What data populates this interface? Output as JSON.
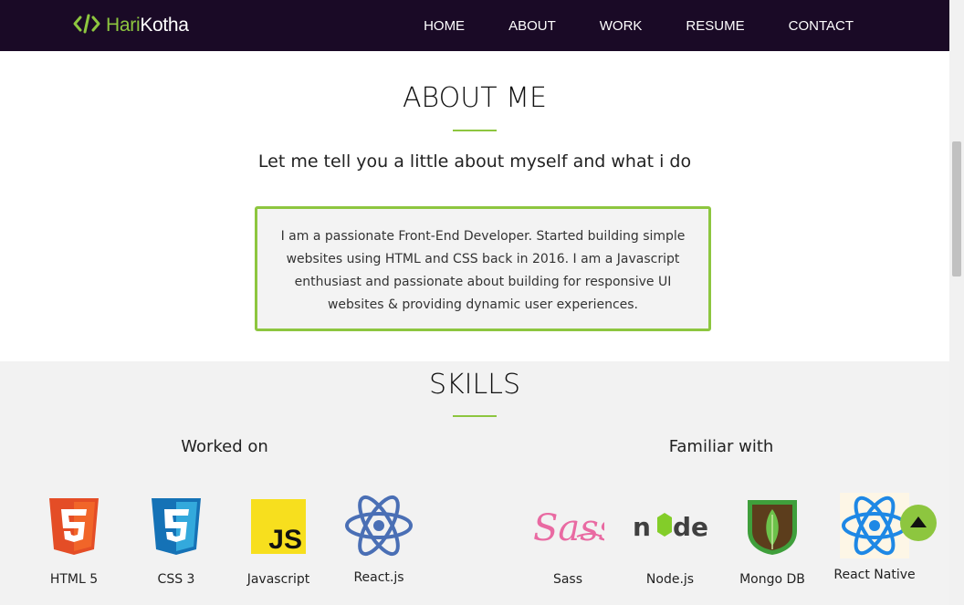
{
  "brand": {
    "part1": "Hari",
    "part2": "Kotha",
    "icon": "code-icon"
  },
  "nav": {
    "items": [
      "HOME",
      "ABOUT",
      "WORK",
      "RESUME",
      "CONTACT"
    ]
  },
  "about": {
    "title": "ABOUT ME",
    "subtitle": "Let me tell you a little about myself and what i do",
    "bio": "I am a passionate Front-End Developer. Started building simple websites using HTML and CSS back in 2016. I am a Javascript enthusiast and passionate about building for responsive UI websites & providing dynamic user experiences."
  },
  "skills": {
    "title": "SKILLS",
    "worked_on": {
      "title": "Worked on",
      "items": [
        {
          "label": "HTML 5",
          "icon": "html5-icon"
        },
        {
          "label": "CSS 3",
          "icon": "css3-icon"
        },
        {
          "label": "Javascript",
          "icon": "javascript-icon"
        },
        {
          "label": "React.js",
          "icon": "react-icon"
        }
      ]
    },
    "familiar_with": {
      "title": "Familiar with",
      "items": [
        {
          "label": "Sass",
          "icon": "sass-icon"
        },
        {
          "label": "Node.js",
          "icon": "nodejs-icon"
        },
        {
          "label": "Mongo DB",
          "icon": "mongodb-icon"
        },
        {
          "label": "React Native",
          "icon": "react-native-icon"
        }
      ]
    }
  },
  "colors": {
    "accent": "#8dc63f",
    "nav_bg": "#1a0a26",
    "section_bg": "#f2f2f2"
  },
  "scroll_top_icon": "arrow-up-icon"
}
